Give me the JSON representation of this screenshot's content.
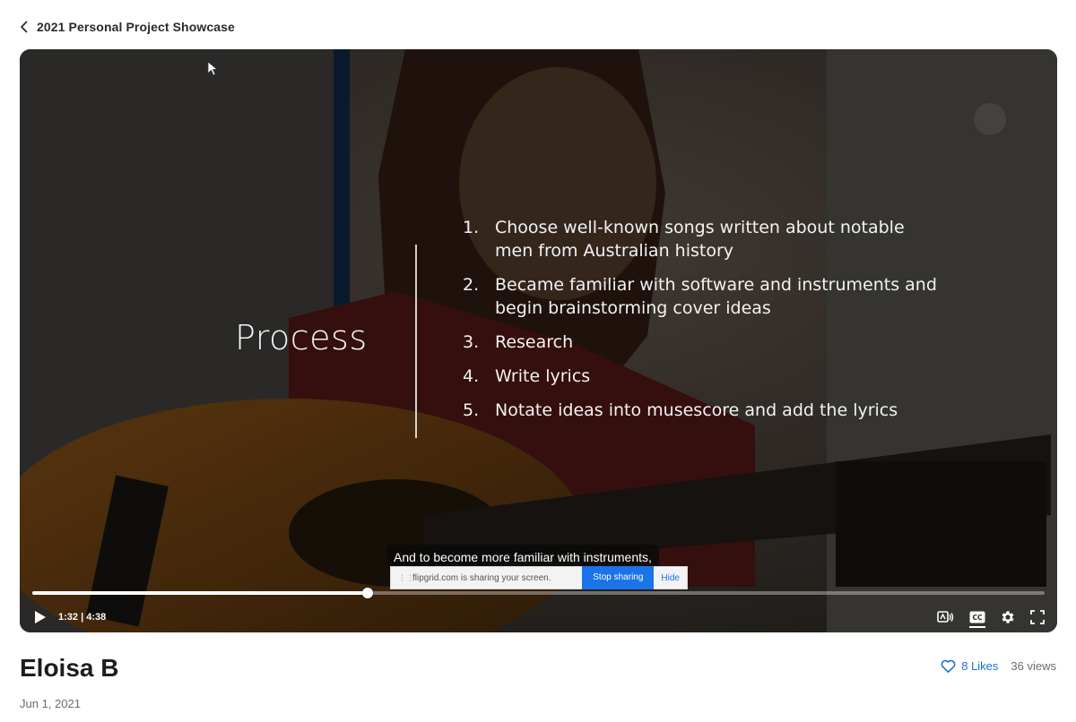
{
  "header": {
    "back_title": "2021 Personal Project Showcase"
  },
  "slide": {
    "title": "Process",
    "items": [
      {
        "num": "1.",
        "text": "Choose well-known songs written about notable men from Australian history"
      },
      {
        "num": "2.",
        "text": "Became familiar with software and instruments and begin brainstorming cover ideas"
      },
      {
        "num": "3.",
        "text": "Research"
      },
      {
        "num": "4.",
        "text": "Write lyrics"
      },
      {
        "num": "5.",
        "text": "Notate ideas into musescore and add the lyrics"
      }
    ]
  },
  "caption": "And to become more familiar with instruments,",
  "share_bar": {
    "text": "flipgrid.com is sharing your screen.",
    "stop_label": "Stop sharing",
    "hide_label": "Hide"
  },
  "player": {
    "current_time": "1:32",
    "duration": "4:38",
    "time_display": "1:32 | 4:38",
    "progress_fraction": 0.331,
    "controls": [
      "audio-description-icon",
      "closed-captions-icon",
      "settings-gear-icon",
      "fullscreen-icon"
    ]
  },
  "post": {
    "author": "Eloisa B",
    "date": "Jun 1, 2021",
    "likes_label": "8 Likes",
    "views_label": "36 views"
  },
  "colors": {
    "accent": "#1a6fd8",
    "share_button": "#1a73e8"
  }
}
